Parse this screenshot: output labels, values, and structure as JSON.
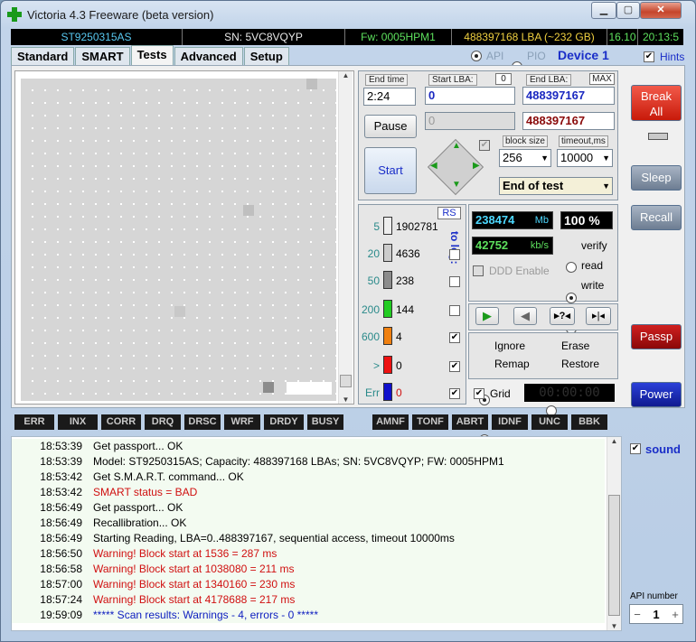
{
  "window": {
    "title": "Victoria 4.3 Freeware (beta version)",
    "min": "▁",
    "max": "▢",
    "close": "✕"
  },
  "info": {
    "model": "ST9250315AS",
    "serial": "SN: 5VC8VQYP",
    "firmware": "Fw: 0005HPM1",
    "lba": "488397168 LBA (~232 GB)",
    "time1": "16.10",
    "time2": "20:13:5"
  },
  "tabs": [
    "Standard",
    "SMART",
    "Tests",
    "Advanced",
    "Setup"
  ],
  "api": {
    "api_label": "API",
    "pio_label": "PIO",
    "device": "Device 1",
    "hints": "Hints"
  },
  "test": {
    "end_time_label": "End time",
    "end_time": "2:24",
    "start_lba_label": "Start LBA:",
    "start_lba_zero": "0",
    "start_lba": "0",
    "start_lba2": "0",
    "end_lba_label": "End LBA:",
    "max_label": "MAX",
    "end_lba": "488397167",
    "end_lba2": "488397167",
    "pause": "Pause",
    "start": "Start",
    "block_size_label": "block size",
    "block_size": "256",
    "timeout_label": "timeout,ms",
    "timeout": "10000",
    "end_mode": "End of test"
  },
  "counters": {
    "rs": "RS",
    "to_log": "to log:",
    "rows": [
      {
        "label": "5",
        "count": "1902781",
        "color": "#eeeeee",
        "checked": ""
      },
      {
        "label": "20",
        "count": "4636",
        "color": "#cccccc",
        "checked": ""
      },
      {
        "label": "50",
        "count": "238",
        "color": "#8c8c8c",
        "checked": ""
      },
      {
        "label": "200",
        "count": "144",
        "color": "#22cc22",
        "checked": ""
      },
      {
        "label": "600",
        "count": "4",
        "color": "#f08010",
        "checked": "✔"
      },
      {
        "label": ">",
        "count": "0",
        "color": "#ee1111",
        "checked": "✔"
      },
      {
        "label": "Err",
        "count": "0",
        "color": "#1010cc",
        "checked": "✔"
      }
    ]
  },
  "stats": {
    "mb": "238474",
    "mb_unit": "Mb",
    "percent": "100",
    "pct_unit": "%",
    "speed": "42752",
    "speed_unit": "kb/s",
    "ddd": "DDD Enable",
    "verify": "verify",
    "read": "read",
    "write": "write"
  },
  "actions": {
    "ignore": "Ignore",
    "erase": "Erase",
    "remap": "Remap",
    "restore": "Restore",
    "grid": "Grid",
    "timer": "00:00:00"
  },
  "side": {
    "break": "Break All",
    "sleep": "Sleep",
    "recall": "Recall",
    "passp": "Passp",
    "power": "Power",
    "sound": "sound",
    "api_number": "API number",
    "api_value": "1",
    "minus": "−",
    "plus": "+"
  },
  "legend": [
    "ERR",
    "INX",
    "CORR",
    "DRQ",
    "DRSC",
    "WRF",
    "DRDY",
    "BUSY",
    "AMNF",
    "TONF",
    "ABRT",
    "IDNF",
    "UNC",
    "BBK"
  ],
  "log": [
    {
      "t": "18:53:39",
      "m": "Get passport... OK",
      "c": "#000"
    },
    {
      "t": "18:53:39",
      "m": "Model: ST9250315AS; Capacity: 488397168 LBAs; SN: 5VC8VQYP; FW: 0005HPM1",
      "c": "#000"
    },
    {
      "t": "18:53:42",
      "m": "Get S.M.A.R.T. command... OK",
      "c": "#000"
    },
    {
      "t": "18:53:42",
      "m": "SMART status = BAD",
      "c": "#d01010"
    },
    {
      "t": "18:56:49",
      "m": "Get passport... OK",
      "c": "#000"
    },
    {
      "t": "18:56:49",
      "m": "Recallibration... OK",
      "c": "#000"
    },
    {
      "t": "18:56:49",
      "m": "Starting Reading, LBA=0..488397167, sequential access, timeout 10000ms",
      "c": "#000"
    },
    {
      "t": "18:56:50",
      "m": "Warning! Block start at 1536 = 287 ms",
      "c": "#d01010"
    },
    {
      "t": "18:56:58",
      "m": "Warning! Block start at 1038080 = 211 ms",
      "c": "#d01010"
    },
    {
      "t": "18:57:00",
      "m": "Warning! Block start at 1340160 = 230 ms",
      "c": "#d01010"
    },
    {
      "t": "18:57:24",
      "m": "Warning! Block start at 4178688 = 217 ms",
      "c": "#d01010"
    },
    {
      "t": "19:59:09",
      "m": "***** Scan results: Warnings - 4, errors - 0 *****",
      "c": "#1020c0"
    }
  ]
}
